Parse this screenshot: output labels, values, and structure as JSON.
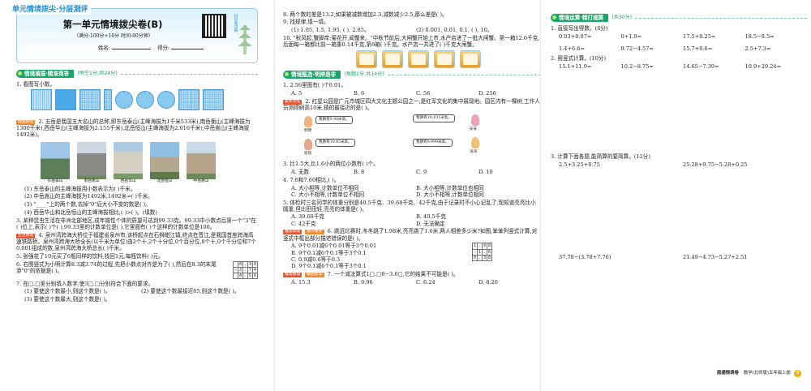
{
  "header": {
    "series_tag": "单元情境拨尖·分层测评",
    "title": "第一单元情境拨尖卷(B)",
    "meta": "（满分:100分+10分    时间:80分钟）",
    "name_label": "姓名:",
    "score_label": "得分:",
    "qr_caption": "扫码看讲解"
  },
  "section1": {
    "label": "情境填描·精准落答",
    "points": "(每空1分,共24分)"
  },
  "q1": "1. 看图写小数。",
  "q2": {
    "tag": "地理情境",
    "text": "2. 五岳是我国五大名山的总称,即东岳泰山(主峰海拔为1千米533米),南岳衡山(主峰海拔为1300千米),西岳华山(主峰海拔为2.155千米),北岳恒山(主峰海拔为2.016千米),中岳嵩山(主峰海拔1492米)。",
    "photos": [
      "东岳泰山",
      "南岳衡山",
      "西岳华山",
      "北岳恒山",
      "中岳嵩山"
    ],
    "s1": "(1) 东岳泰山的主峰海拔用小数表示为(        )千米。",
    "s2": "(2) 中岳嵩山的主峰海拔为1492米,1492米=(        )千米。",
    "s3": "(3) \"____\"上的两个数,去掉\"0\"后大小不变的数是(        )。",
    "s4": "(4) 西岳华山和北岳恒山的主峰海拔相比,(        )>(        )。(填数)"
  },
  "q3": "3. 某种昆虫生活在非洲北部地区,成年雄性个体的质量可达到99.33克。99.33中小数点后第一个\"3\"在(    )位上,表示(    )个(    ),99.33里的计数单位是(    ),它里面有(    )个这样的计数单位是100。",
  "q4": {
    "tag": "生活情境",
    "text": "4. 泉州湾跨海大桥位于福建省泉州市,该桥起点在石狮蚶江镇,终点在晋江,是我国首座跨海高速铁路桥。泉州湾跨海大桥全长(以千米为单位)由2个十,2个十分位,0个百分位,8个十,0个千分位和7个0.001组成的数,泉州湾跨海大桥总长(        )千米。"
  },
  "q5": "5. 张强花了10元买了6瓶同样的饮料,找回1元,每瓶饮料(        )元。",
  "q6": {
    "text": "6. 右图竖式为小明计算8.3减3.74的过程,先把小数点对齐是为了(        ),然后在8.3的末尾添\"0\"的依据是(        )。",
    "rows": [
      [
        "",
        "8",
        ".",
        "3",
        "0"
      ],
      [
        "−",
        "3",
        ".",
        "7",
        "4"
      ],
      [
        "",
        "4",
        ".",
        "5",
        "6"
      ]
    ]
  },
  "q7": {
    "text": "7. 在□.□里分别填入数字,使3□.□分别符合下面的要求。",
    "s1": "(1) 要使这个数最小,则这个数是(        )。",
    "s2": "(2) 要使这个数最接近85,则这个数是(        )。",
    "s3": "(3) 要使这个数最大,则这个数是(        )。"
  },
  "q8": "8. 两个数的差是13.2,如果被减数增加2.3,减数减少2.5,那么差是(        )。",
  "q9": {
    "text": "9. 找规律,填一填。",
    "s1": "(1) 1.05, 1.5, 1.95, (        ), 2.85。",
    "s2": "(2) 0.001, 0.01, 0.1, (        ), 10。"
  },
  "q10": "10. \"秋风起,蟹脚痒;菊花开,闻蟹来。\"中秋节前后,大闸蟹开始上市,水产店进了一批大闸蟹。第一箱12.6千克,后面每一箱都比前一箱重0.14千克,第6箱(    )千克。水产店一共进了(        )千克大闸蟹。",
  "section2": {
    "label": "情境甄选·明辨是非",
    "points": "(每题2分,共14分)"
  },
  "mc1": {
    "q": "1. 2.56里面有(        )个0.01。",
    "opts": [
      "A. 5",
      "B. 6",
      "C. 56",
      "D. 256"
    ]
  },
  "mc2": {
    "tag": "家乡文化",
    "q": "2. 红星公园是广元市城区四大文化主题公园之一,是红军文化的集中展现地。园区内有一棵树,工作人员测得树高10米,猜的最接近的是(        )。",
    "bubbles": [
      "我猜有9.98米高。",
      "我猜有10.101米高。",
      "我猜有10.05米高。",
      "我猜有9.999米高。"
    ],
    "names": [
      "明明",
      "安安",
      "丽丽",
      "涛涛"
    ]
  },
  "mc3": {
    "q": "3. 比1.5大,比1.6小的两位小数有(        )个。",
    "opts": [
      "A. 无数",
      "B. 8",
      "C. 9",
      "D. 10"
    ]
  },
  "mc4": {
    "q": "4. 7.6和7.60相比,(        )。",
    "opts": [
      "A. 大小相等,计数单位不相同",
      "B. 大小相等,计数单位也相同",
      "C. 大小不相等,计数单位不相同",
      "D. 大小不相等,计数单位相同"
    ]
  },
  "mc5": {
    "q": "5. 体检时三名同学的体重分别是40.5千克、39.68千克、42千克,由于记录时不小心记乱了,现知道亮亮比小圆重,但比田田轻,亮亮的体重是(        )。",
    "opts": [
      "A. 39.68千克",
      "B. 40.5千克",
      "C. 42千克",
      "D. 无法确定"
    ]
  },
  "mc6": {
    "tags": [
      "推理情境",
      "数学素养"
    ],
    "q": "6. 跳远比赛时,冬冬跳了1.98米,亮亮跳了1.6米,两人相差多少米?如图,笨笨列竖式计算,对竖式中框出部分描述错误的是(        )。",
    "opts": [
      "A. 9个0.01减6个0.01等于3个0.01",
      "B. 9个0.1减6个0.1等于3个0.1",
      "C. 0.9减0.6等于0.3",
      "D. 9个0.1减6个0.1等于3个0.1"
    ],
    "rows": [
      [
        "1",
        ".",
        "9",
        "8"
      ],
      [
        "-",
        "1",
        ".",
        "6"
      ],
      [
        "0",
        ".",
        "3",
        "8"
      ]
    ]
  },
  "mc7": {
    "tags": [
      "推理情境",
      "解题新意"
    ],
    "q": "7. 一个减法算式1□.□8−3.6□,它的结果不可能是(        )。",
    "opts": [
      "A. 15.3",
      "B. 9.96",
      "C. 6.24",
      "D. 8.26"
    ]
  },
  "section3": {
    "label": "情境运算·精打细算",
    "points": "(共30分)"
  },
  "c1": {
    "text": "1. 直接写出得数。(8分)",
    "rows": [
      [
        "0.03+0.07=",
        "0+1.9=",
        "17.5+0.25=",
        "18.5−8.5="
      ],
      [
        "1.4+6.6=",
        "9.72−4.57=",
        "15.7+0.6=",
        "2.5+7.3="
      ]
    ]
  },
  "c2": {
    "text": "2. 用竖式计算。(10分)",
    "items": [
      "15.1+11.9=",
      "10.2−8.75=",
      "14.65−7.39=",
      "10.9+29.24="
    ]
  },
  "c3": {
    "text": "3. 计算下面各题,能简算的要简算。(12分)",
    "items": [
      "2.5+3.25+0.75",
      "25.28+9.75−5.28+0.25",
      "37.78−(3.78+7.76)",
      "21.49−4.73−5.27+2.51"
    ]
  },
  "footer": {
    "brand": "南通情境卷",
    "subject": "数学(北师版)五年级上册",
    "page": "3"
  },
  "colors": {
    "accent": "#1aa56a",
    "title_blue": "#1e8fd6",
    "tag_orange": "#ef8b2e"
  }
}
